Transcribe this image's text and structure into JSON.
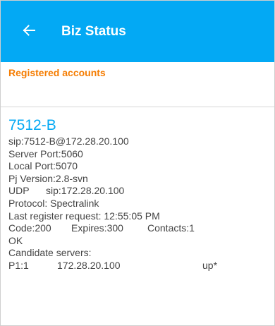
{
  "header": {
    "title": "Biz Status"
  },
  "section": {
    "label": "Registered accounts"
  },
  "account": {
    "name": "7512-B",
    "sip_uri": "sip:7512-B@172.28.20.100",
    "server_port": "Server Port:5060",
    "local_port": "Local Port:5070",
    "pj_version": "Pj Version:2.8-svn",
    "transport": "UDP",
    "transport_uri": "sip:172.28.20.100",
    "protocol": "Protocol: Spectralink",
    "last_register": "Last register request: 12:55:05 PM",
    "code": "Code:200",
    "expires": "Expires:300",
    "contacts": "Contacts:1",
    "status": "OK",
    "candidate_label": "Candidate servers:",
    "candidate": {
      "priority": "P1:1",
      "host": "172.28.20.100",
      "state": "up*"
    }
  }
}
